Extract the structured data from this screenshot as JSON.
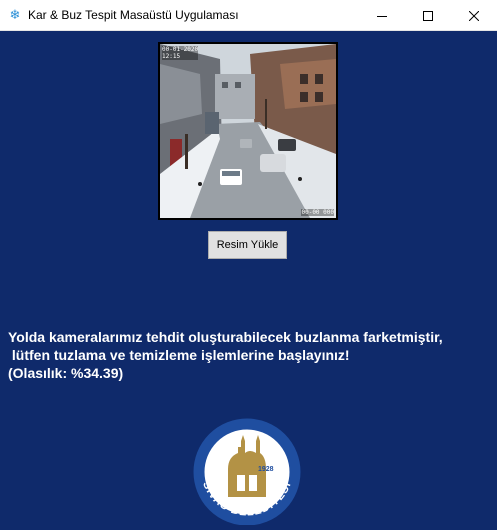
{
  "window": {
    "title": "Kar & Buz Tespit Masaüstü Uygulaması",
    "icon": "snowflake-icon",
    "controls": [
      "minimize-icon",
      "maximize-icon",
      "close-icon"
    ]
  },
  "camera": {
    "description_icon": "camera-image",
    "overlay_top_line1": "00-01-2020",
    "overlay_top_line2": "12:15",
    "overlay_bottom": "00-00 000"
  },
  "upload_button": {
    "label": "Resim Yükle"
  },
  "result": {
    "line1": "Yolda kameralarımız tehdit oluşturabilecek buzlanma farketmiştir,",
    "line2": " lütfen tuzlama ve temizleme işlemlerine başlayınız!",
    "line3": "(Olasılık: %34.39)"
  },
  "logo": {
    "text": "SİVAS BELEDİYESİ",
    "year": "1928"
  },
  "colors": {
    "background": "#0f2a6b",
    "text": "#ffffff",
    "logo_blue": "#1f4ea0",
    "logo_gold": "#b39245"
  }
}
